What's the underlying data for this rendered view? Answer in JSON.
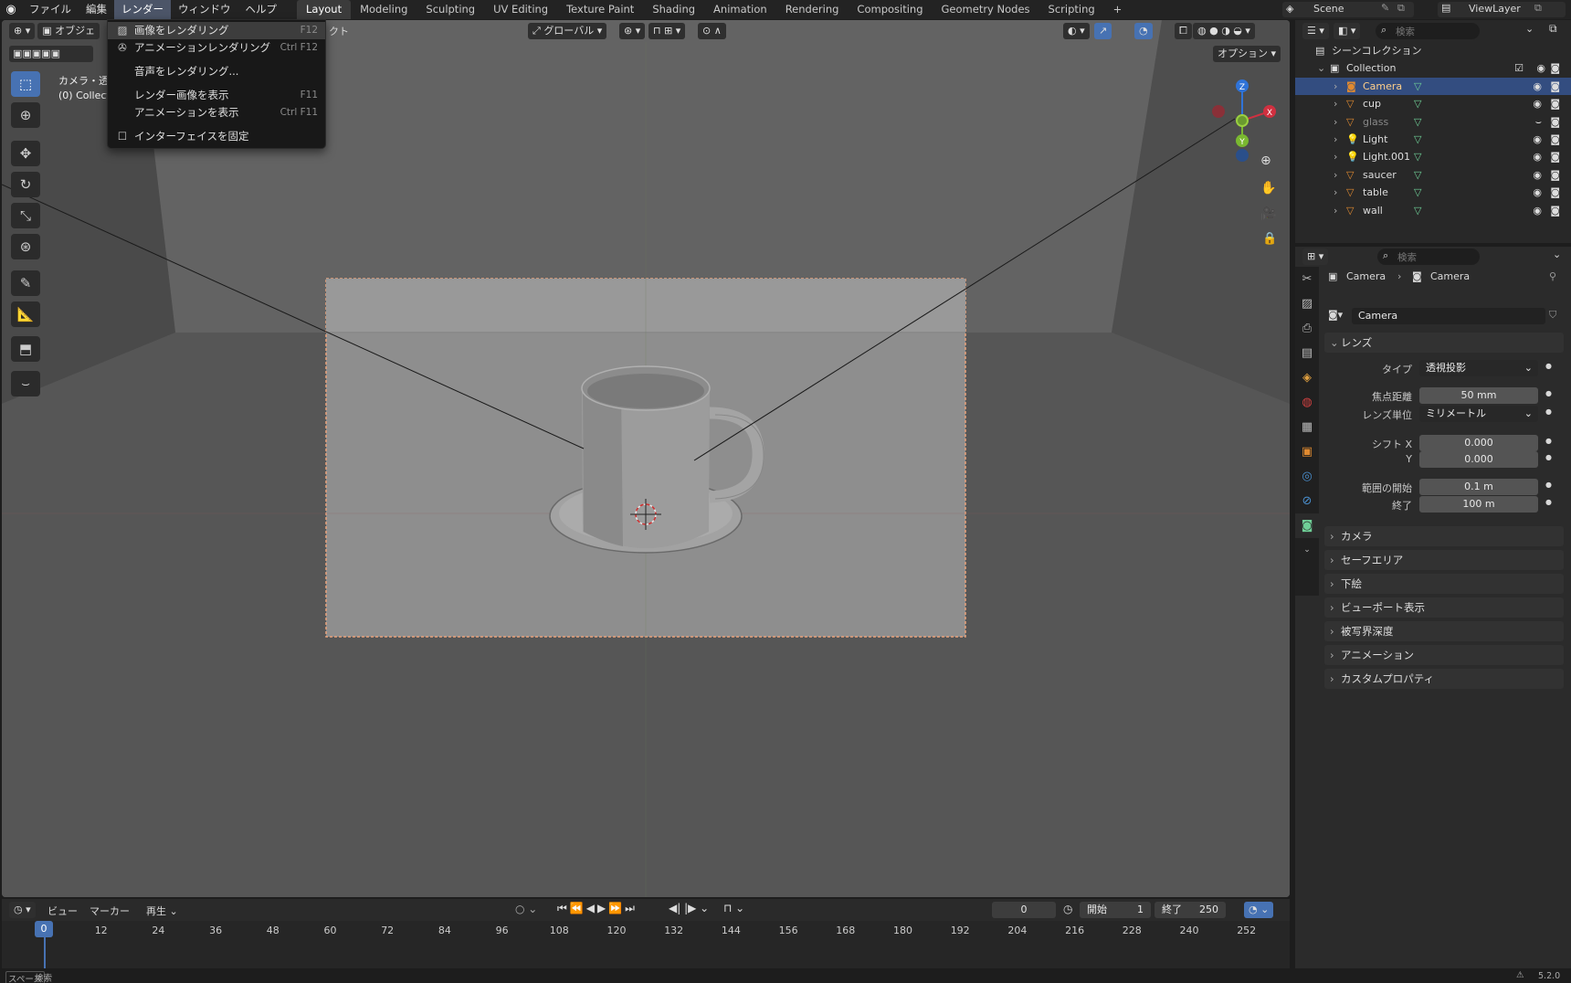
{
  "menubar": {
    "items": [
      "ファイル",
      "編集",
      "レンダー",
      "ウィンドウ",
      "ヘルプ"
    ],
    "active_index": 2
  },
  "workspaces": {
    "tabs": [
      "Layout",
      "Modeling",
      "Sculpting",
      "UV Editing",
      "Texture Paint",
      "Shading",
      "Animation",
      "Rendering",
      "Compositing",
      "Geometry Nodes",
      "Scripting"
    ],
    "active_index": 0,
    "add_label": "+"
  },
  "scene": {
    "label": "Scene",
    "view_layer": "ViewLayer"
  },
  "render_menu": {
    "items": [
      {
        "label": "画像をレンダリング",
        "shortcut": "F12",
        "highlight": true
      },
      {
        "label": "アニメーションレンダリング",
        "shortcut": "Ctrl F12"
      },
      {
        "label": "音声をレンダリング...",
        "shortcut": ""
      },
      {
        "label": "レンダー画像を表示",
        "shortcut": "F11"
      },
      {
        "label": "アニメーションを表示",
        "shortcut": "Ctrl F11"
      },
      {
        "label": "インターフェイスを固定",
        "shortcut": ""
      }
    ]
  },
  "viewport": {
    "mode_label": "オブジェ",
    "object_label": "クト",
    "transform_orientation": "グローバル",
    "options_label": "オプション",
    "overlay_text_1": "カメラ・透",
    "overlay_text_2": "(0) Collect",
    "gizmo_axes": {
      "z": "Z",
      "x": "X",
      "y": "Y"
    }
  },
  "outliner": {
    "search_placeholder": "検索",
    "scene_collection": "シーンコレクション",
    "collection": "Collection",
    "objects": [
      {
        "name": "Camera",
        "selected": true,
        "type": "camera"
      },
      {
        "name": "cup",
        "type": "mesh"
      },
      {
        "name": "glass",
        "type": "mesh",
        "dim": true
      },
      {
        "name": "Light",
        "type": "light"
      },
      {
        "name": "Light.001",
        "type": "light"
      },
      {
        "name": "saucer",
        "type": "mesh"
      },
      {
        "name": "table",
        "type": "mesh"
      },
      {
        "name": "wall",
        "type": "mesh"
      }
    ]
  },
  "properties": {
    "search_placeholder": "検索",
    "breadcrumb_object": "Camera",
    "breadcrumb_data": "Camera",
    "data_name": "Camera",
    "lens_panel": "レンズ",
    "type_label": "タイプ",
    "type_value": "透視投影",
    "focal_label": "焦点距離",
    "focal_value": "50 mm",
    "lens_unit_label": "レンズ単位",
    "lens_unit_value": "ミリメートル",
    "shift_x_label": "シフト X",
    "shift_x_value": "0.000",
    "shift_y_label": "Y",
    "shift_y_value": "0.000",
    "clip_start_label": "範囲の開始",
    "clip_start_value": "0.1 m",
    "clip_end_label": "終了",
    "clip_end_value": "100 m",
    "panels": [
      "カメラ",
      "セーフエリア",
      "下絵",
      "ビューポート表示",
      "被写界深度",
      "アニメーション",
      "カスタムプロパティ"
    ]
  },
  "timeline": {
    "menus": [
      "ビュー",
      "マーカー",
      "再生"
    ],
    "current_frame": "0",
    "start_label": "開始",
    "start_value": "1",
    "end_label": "終了",
    "end_value": "250",
    "playhead": "0",
    "ticks": [
      "12",
      "24",
      "36",
      "48",
      "60",
      "72",
      "84",
      "96",
      "108",
      "120",
      "132",
      "144",
      "156",
      "168",
      "180",
      "192",
      "204",
      "216",
      "228",
      "240",
      "252"
    ]
  },
  "statusbar": {
    "left": "スペース",
    "left2": "検索",
    "version": "5.2.0"
  }
}
